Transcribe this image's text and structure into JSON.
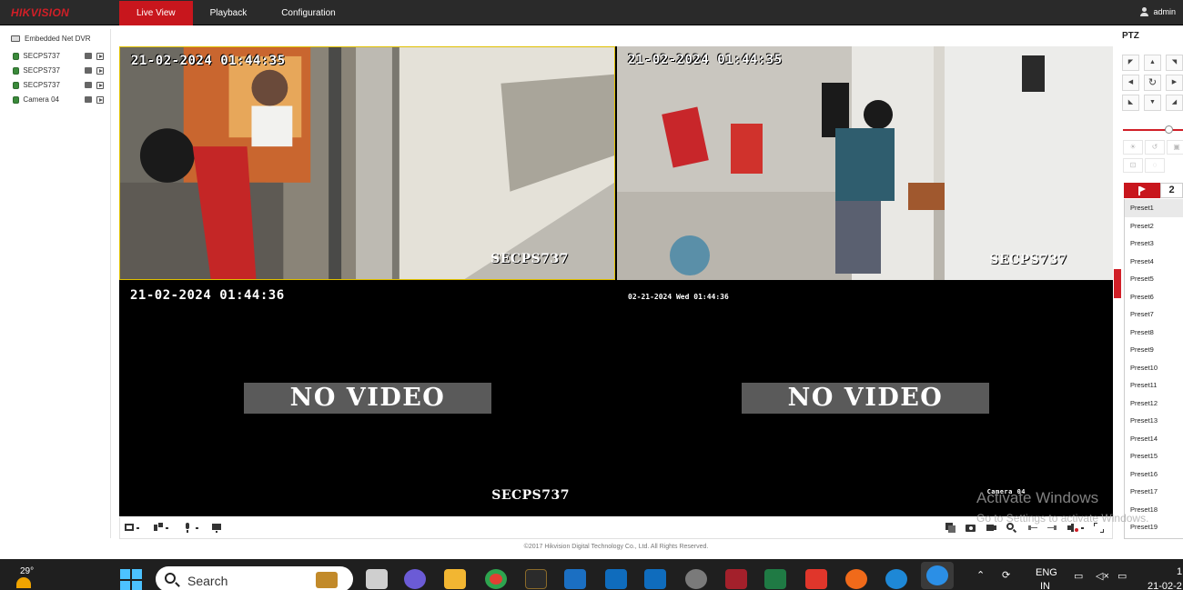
{
  "app": {
    "logo": "HIKVISION",
    "nav_tabs": [
      {
        "label": "Live View",
        "active": true
      },
      {
        "label": "Playback",
        "active": false
      },
      {
        "label": "Configuration",
        "active": false
      }
    ],
    "user": "admin",
    "brand_color": "#c8161d"
  },
  "device_tree": {
    "dvr": "Embedded Net DVR",
    "cameras": [
      "SECPS737",
      "SECPS737",
      "SECPS737",
      "Camera 04"
    ]
  },
  "tiles": [
    {
      "time": "21-02-2024 01:44:35",
      "name": "SECPS737",
      "state": "video"
    },
    {
      "time": "21-02-2024 01:44:35",
      "name": "SECPS737",
      "state": "video"
    },
    {
      "time": "21-02-2024 01:44:36",
      "name": "SECPS737",
      "state": "no-video",
      "message": "NO VIDEO"
    },
    {
      "time": "02-21-2024 Wed 01:44:36",
      "name": "Camera 04",
      "state": "no-video",
      "message": "NO VIDEO"
    }
  ],
  "footer": "©2017 Hikvision Digital Technology Co., Ltd. All Rights Reserved.",
  "ptz": {
    "title": "PTZ",
    "presets": [
      "Preset1",
      "Preset2",
      "Preset3",
      "Preset4",
      "Preset5",
      "Preset6",
      "Preset7",
      "Preset8",
      "Preset9",
      "Preset10",
      "Preset11",
      "Preset12",
      "Preset13",
      "Preset14",
      "Preset15",
      "Preset16",
      "Preset17",
      "Preset18",
      "Preset19"
    ],
    "tab2_label": "2"
  },
  "watermark": {
    "title": "Activate Windows",
    "subtitle": "Go to Settings to activate Windows."
  },
  "taskbar": {
    "temperature": "29°",
    "search_placeholder": "Search",
    "language_1": "ENG",
    "language_2": "IN",
    "clock_time": "1",
    "clock_date": "21-02-2"
  }
}
